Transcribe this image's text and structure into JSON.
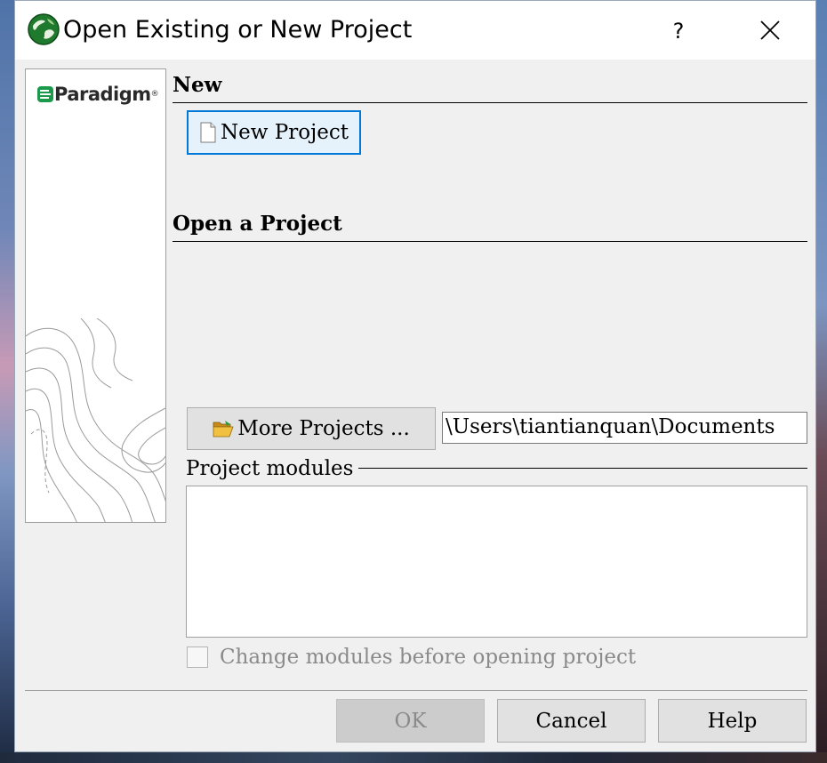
{
  "window": {
    "title": "Open Existing or New Project",
    "help_glyph": "?",
    "app_icon": "green-globe-icon",
    "close_icon": "close-icon"
  },
  "sidebar": {
    "logo_text": "Paradigm",
    "logo_mark": "®",
    "brand_color": "#1a9a4a"
  },
  "new_section": {
    "title": "New",
    "new_project_label": "New Project"
  },
  "open_section": {
    "title": "Open a Project",
    "more_projects_label": "More Projects ...",
    "path_value": "\\Users\\tiantianquan\\Documents"
  },
  "modules": {
    "group_label": "Project modules",
    "change_modules_label": "Change modules before opening project",
    "change_modules_checked": false
  },
  "footer": {
    "ok_label": "OK",
    "cancel_label": "Cancel",
    "help_label": "Help"
  }
}
